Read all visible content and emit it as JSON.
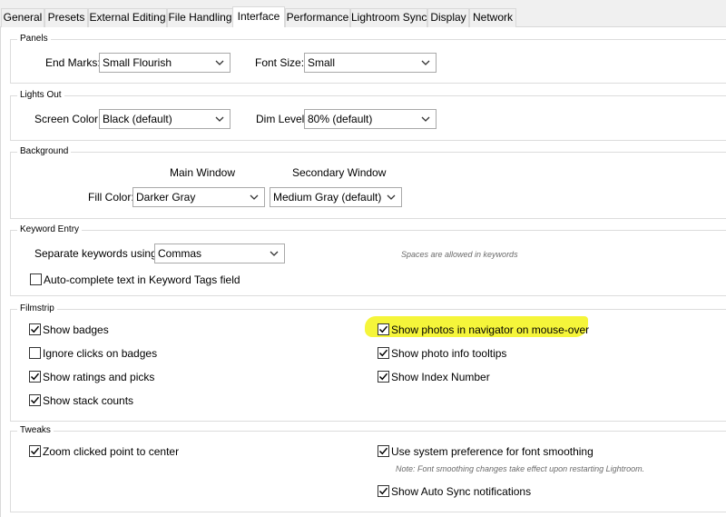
{
  "tabs": [
    "General",
    "Presets",
    "External Editing",
    "File Handling",
    "Interface",
    "Performance",
    "Lightroom Sync",
    "Display",
    "Network"
  ],
  "active_tab": "Interface",
  "panels": {
    "title": "Panels",
    "end_marks_label": "End Marks:",
    "end_marks_value": "Small Flourish",
    "font_size_label": "Font Size:",
    "font_size_value": "Small"
  },
  "lights_out": {
    "title": "Lights Out",
    "screen_color_label": "Screen Color:",
    "screen_color_value": "Black (default)",
    "dim_level_label": "Dim Level:",
    "dim_level_value": "80% (default)"
  },
  "background": {
    "title": "Background",
    "main_window_label": "Main Window",
    "secondary_window_label": "Secondary Window",
    "fill_color_label": "Fill Color:",
    "main_fill_value": "Darker Gray",
    "secondary_fill_value": "Medium Gray (default)"
  },
  "keyword_entry": {
    "title": "Keyword Entry",
    "separate_label": "Separate keywords using:",
    "separate_value": "Commas",
    "spaces_hint": "Spaces are allowed in keywords",
    "autocomplete_label": "Auto-complete text in Keyword Tags field",
    "autocomplete_checked": false
  },
  "filmstrip": {
    "title": "Filmstrip",
    "show_badges": {
      "label": "Show badges",
      "checked": true
    },
    "ignore_clicks": {
      "label": "Ignore clicks on badges",
      "checked": false
    },
    "show_ratings": {
      "label": "Show ratings and picks",
      "checked": true
    },
    "show_stack_counts": {
      "label": "Show stack counts",
      "checked": true
    },
    "show_photos_navigator": {
      "label": "Show photos in navigator on mouse-over",
      "checked": true
    },
    "show_photo_info": {
      "label": "Show photo info tooltips",
      "checked": true
    },
    "show_index_number": {
      "label": "Show Index Number",
      "checked": true
    }
  },
  "tweaks": {
    "title": "Tweaks",
    "zoom_clicked": {
      "label": "Zoom clicked point to center",
      "checked": true
    },
    "system_font_smoothing": {
      "label": "Use system preference for font smoothing",
      "checked": true
    },
    "font_note": "Note: Font smoothing changes take effect upon restarting Lightroom.",
    "auto_sync_notifications": {
      "label": "Show Auto Sync notifications",
      "checked": true
    }
  },
  "colors": {
    "highlight": "#f5f53a",
    "border": "#dcdcdc",
    "window_bg": "#f0f0f0"
  }
}
